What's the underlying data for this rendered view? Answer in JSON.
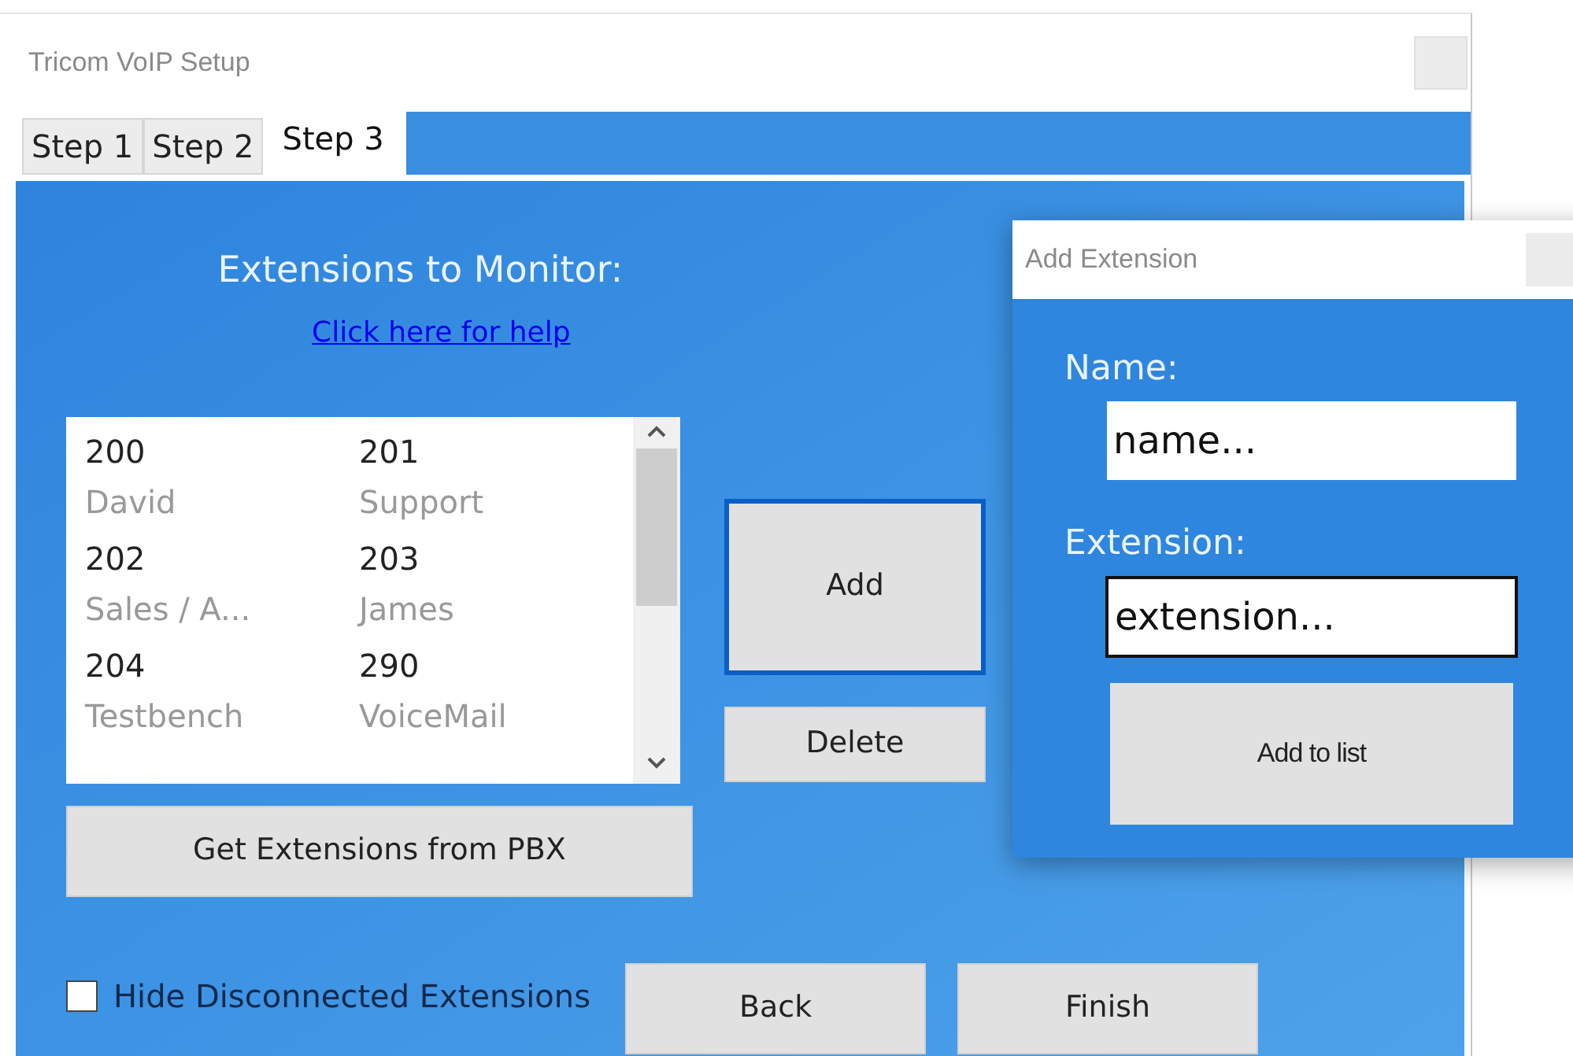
{
  "window": {
    "title": "Tricom VoIP Setup"
  },
  "tabs": [
    {
      "label": "Step 1",
      "selected": false
    },
    {
      "label": "Step 2",
      "selected": false
    },
    {
      "label": "Step 3",
      "selected": true
    }
  ],
  "heading": "Extensions to Monitor:",
  "help_link": "Click here for help",
  "extensions": [
    {
      "number": "200",
      "name": "David"
    },
    {
      "number": "201",
      "name": "Support"
    },
    {
      "number": "202",
      "name": "Sales / A..."
    },
    {
      "number": "203",
      "name": "James"
    },
    {
      "number": "204",
      "name": "Testbench"
    },
    {
      "number": "290",
      "name": "VoiceMail"
    }
  ],
  "buttons": {
    "add": {
      "label": "Add",
      "selected": true
    },
    "delete": {
      "label": "Delete",
      "selected": false
    },
    "get": "Get Extensions from PBX",
    "back": "Back",
    "finish": "Finish"
  },
  "hide_disconnected": {
    "label": "Hide Disconnected Extensions",
    "checked": false
  },
  "dialog": {
    "title": "Add Extension",
    "name_label": "Name:",
    "name_value": "name...",
    "extension_label": "Extension:",
    "extension_value": "extension...",
    "extension_focused": true,
    "button": "Add to list"
  }
}
